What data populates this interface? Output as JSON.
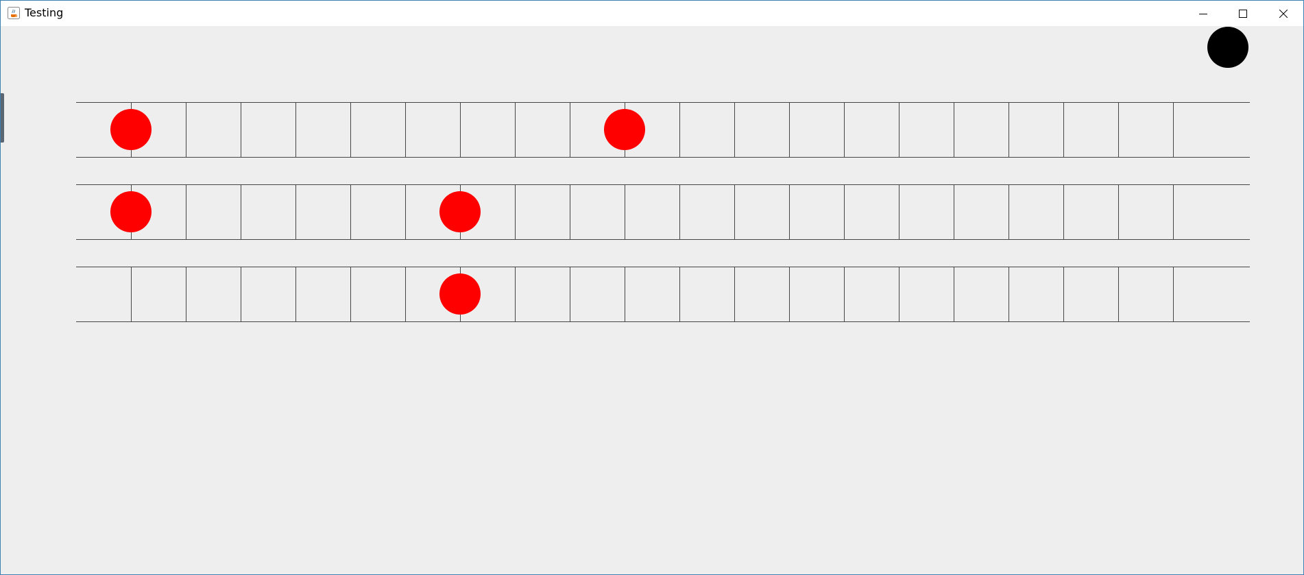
{
  "window": {
    "title": "Testing",
    "icon": "java-coffee-cup-icon",
    "controls": [
      "minimize-icon",
      "maximize-icon",
      "close-icon"
    ]
  },
  "colors": {
    "background": "#eeeeee",
    "grid_line": "#444444",
    "note_marker": "#ff0000",
    "indicator": "#000000"
  },
  "board": {
    "rows": 3,
    "columns": 21,
    "markers": [
      {
        "row": 0,
        "column": 1
      },
      {
        "row": 0,
        "column": 10
      },
      {
        "row": 1,
        "column": 1
      },
      {
        "row": 1,
        "column": 7
      },
      {
        "row": 2,
        "column": 7
      }
    ]
  },
  "indicator": {
    "icon": "black-circle-indicator"
  }
}
